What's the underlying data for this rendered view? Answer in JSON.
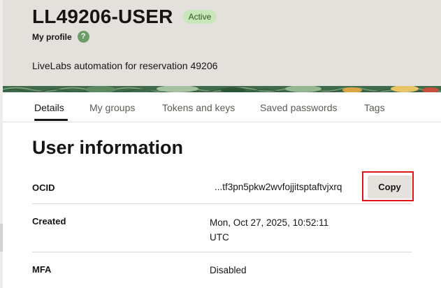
{
  "header": {
    "title": "LL49206-USER",
    "status": "Active",
    "profile_label": "My profile",
    "help_icon_glyph": "?",
    "description": "LiveLabs automation for reservation 49206"
  },
  "tabs": [
    {
      "label": "Details",
      "active": true
    },
    {
      "label": "My groups",
      "active": false
    },
    {
      "label": "Tokens and keys",
      "active": false
    },
    {
      "label": "Saved passwords",
      "active": false
    },
    {
      "label": "Tags",
      "active": false
    }
  ],
  "section": {
    "title": "User information"
  },
  "rows": [
    {
      "label": "OCID",
      "value": "...tf3pn5pkw2wvfojjitsptaftvjxrq",
      "action": "Copy"
    },
    {
      "label": "Created",
      "value_line1": "Mon, Oct 27, 2025, 10:52:11",
      "value_line2": "UTC"
    },
    {
      "label": "MFA",
      "value": "Disabled"
    }
  ],
  "colors": {
    "header_bg": "#e4e1dd",
    "badge_bg": "#c7e6b9",
    "badge_text": "#2e5a1f",
    "highlight": "#e01515",
    "help_icon": "#6a9e66"
  }
}
